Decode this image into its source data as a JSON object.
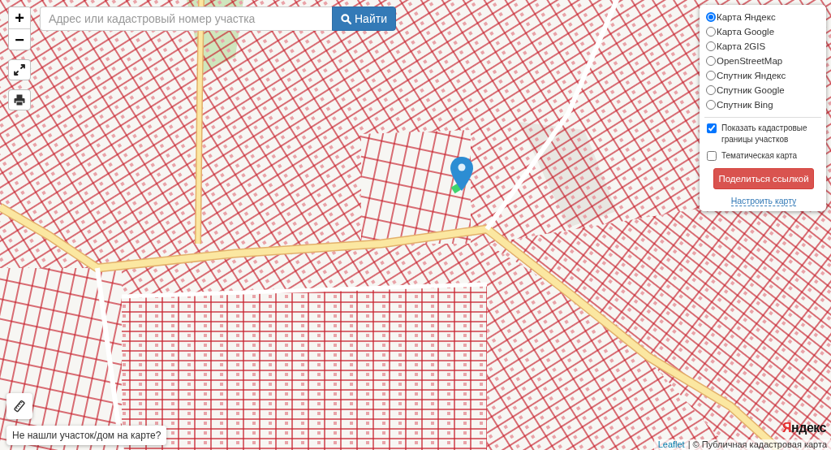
{
  "zoom_control": {
    "zoom_in": "+",
    "zoom_out": "−"
  },
  "search": {
    "placeholder": "Адрес или кадастровый номер участка",
    "button": "Найти"
  },
  "layers_panel": {
    "base_layers": [
      {
        "label": "Карта Яндекс",
        "selected": true
      },
      {
        "label": "Карта Google",
        "selected": false
      },
      {
        "label": "Карта 2GIS",
        "selected": false
      },
      {
        "label": "OpenStreetMap",
        "selected": false
      },
      {
        "label": "Спутник Яндекс",
        "selected": false
      },
      {
        "label": "Спутник Google",
        "selected": false
      },
      {
        "label": "Спутник Bing",
        "selected": false
      }
    ],
    "overlays": [
      {
        "label": "Показать кадастровые границы участков",
        "checked": true
      },
      {
        "label": "Тематическая карта",
        "checked": false
      }
    ],
    "share_button": "Поделиться ссылкой",
    "settings_link": "Настроить карту"
  },
  "help_button": "Не нашли участок/дом на карте?",
  "map": {
    "logo": "Яндекс"
  },
  "attribution": {
    "link": "Leaflet",
    "text": "| © Публичная кадастровая карта"
  }
}
